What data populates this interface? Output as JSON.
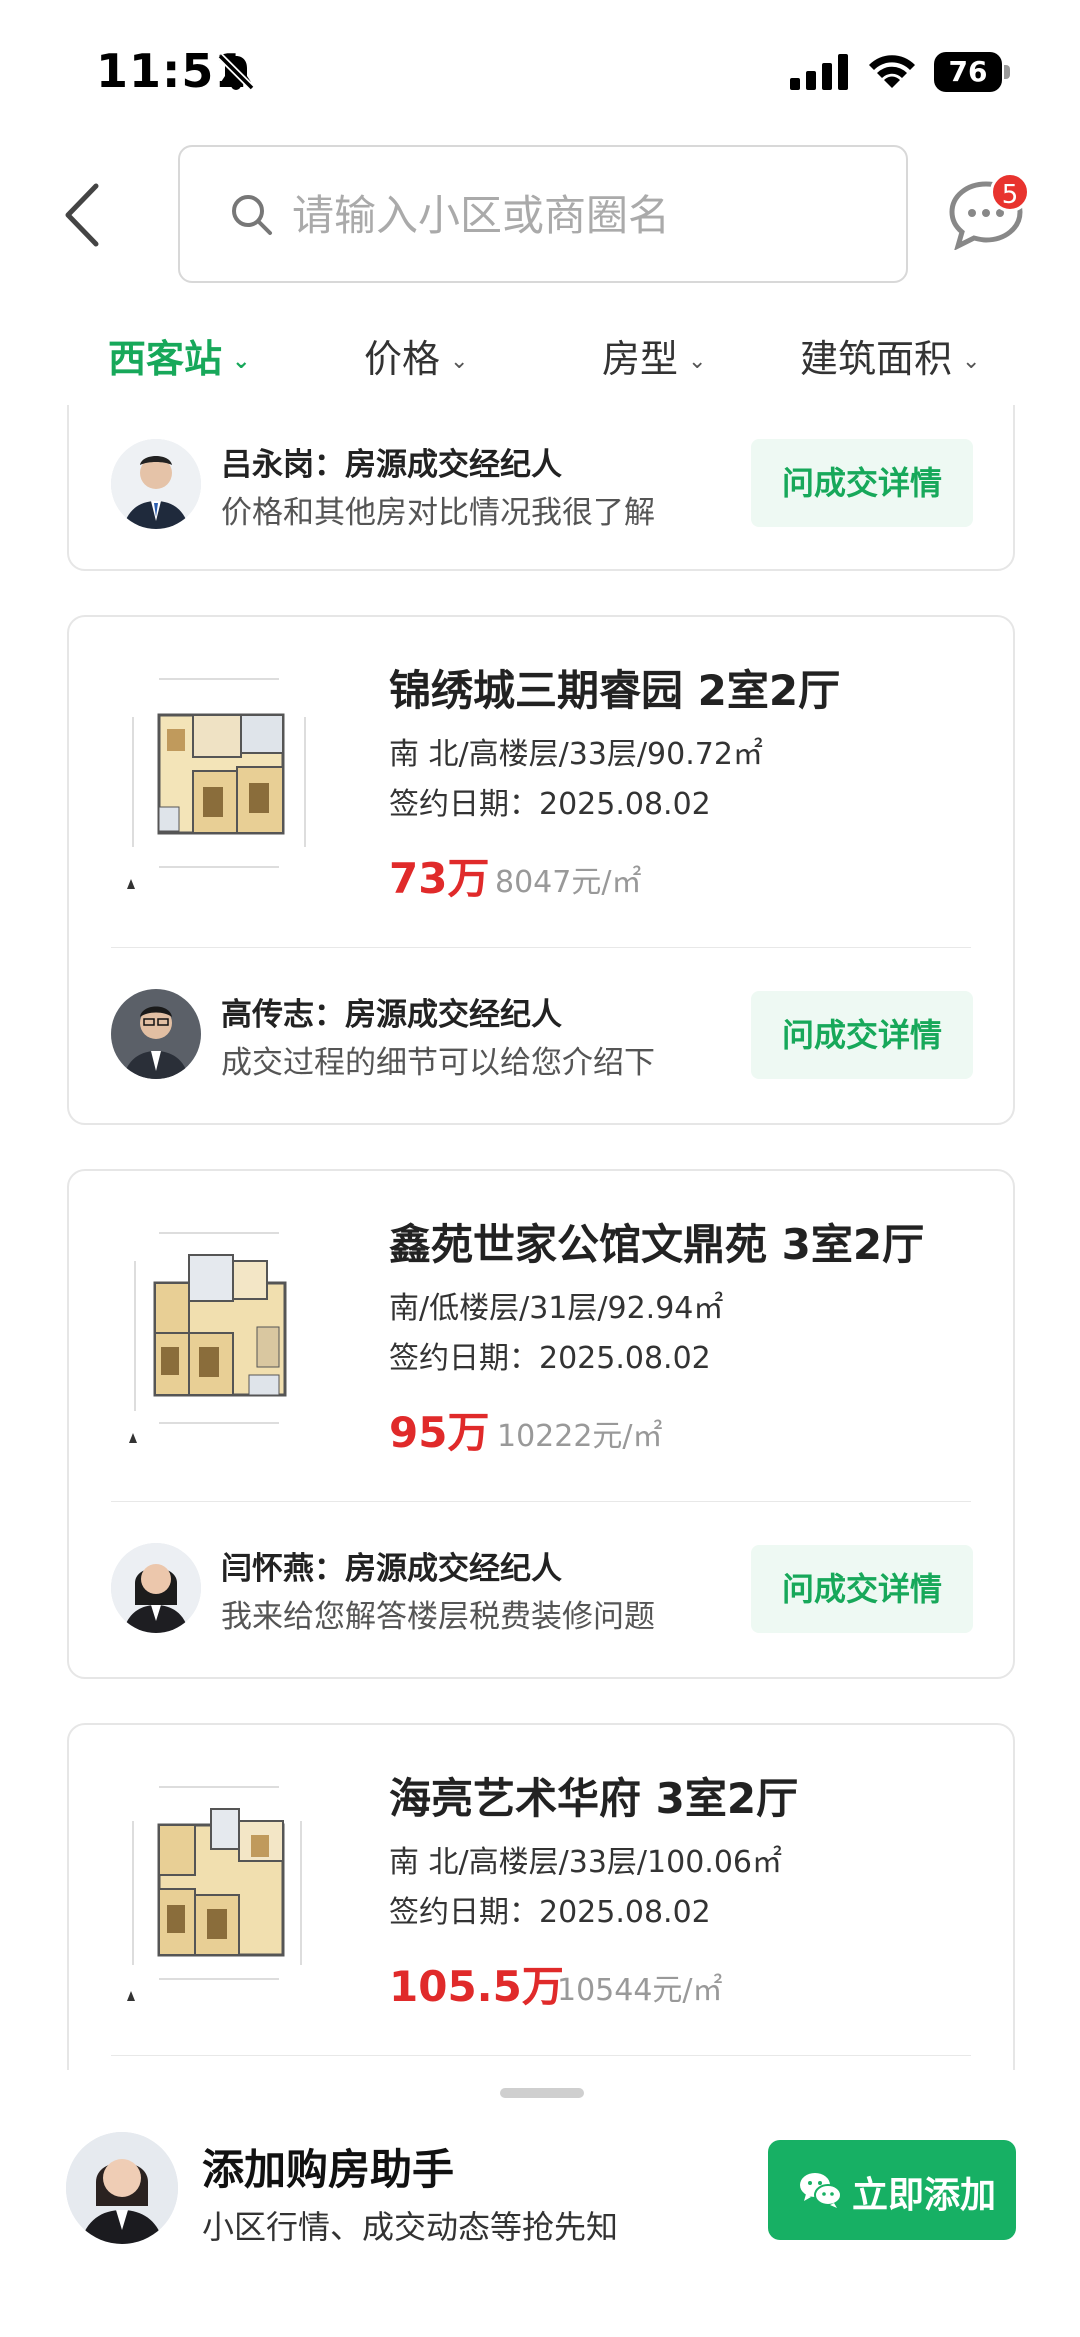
{
  "status_bar": {
    "time": "11:51",
    "battery": "76"
  },
  "search": {
    "placeholder": "请输入小区或商圈名"
  },
  "messages": {
    "badge": "5"
  },
  "filters": [
    {
      "label": "西客站",
      "active": true
    },
    {
      "label": "价格",
      "active": false
    },
    {
      "label": "房型",
      "active": false
    },
    {
      "label": "建筑面积",
      "active": false
    }
  ],
  "partial_agent": {
    "name": "吕永岗：房源成交经纪人",
    "desc": "价格和其他房对比情况我很了解",
    "button": "问成交详情"
  },
  "listings": [
    {
      "title": "锦绣城三期睿园 2室2厅",
      "info": "南 北/高楼层/33层/90.72㎡",
      "date": "签约日期：2025.08.02",
      "price": "73万",
      "unit_price": "8047元/㎡",
      "agent_name": "高传志：房源成交经纪人",
      "agent_desc": "成交过程的细节可以给您介绍下",
      "button": "问成交详情"
    },
    {
      "title": "鑫苑世家公馆文鼎苑 3室2厅",
      "info": "南/低楼层/31层/92.94㎡",
      "date": "签约日期：2025.08.02",
      "price": "95万",
      "unit_price": "10222元/㎡",
      "agent_name": "闫怀燕：房源成交经纪人",
      "agent_desc": "我来给您解答楼层税费装修问题",
      "button": "问成交详情"
    },
    {
      "title": "海亮艺术华府 3室2厅",
      "info": "南 北/高楼层/33层/100.06㎡",
      "date": "签约日期：2025.08.02",
      "price": "105.5万",
      "unit_price": "10544元/㎡"
    }
  ],
  "assistant": {
    "title": "添加购房助手",
    "subtitle": "小区行情、成交动态等抢先知",
    "button": "立即添加"
  },
  "colors": {
    "accent": "#17a85a",
    "price": "#e02a2a",
    "badge": "#e8332e"
  }
}
